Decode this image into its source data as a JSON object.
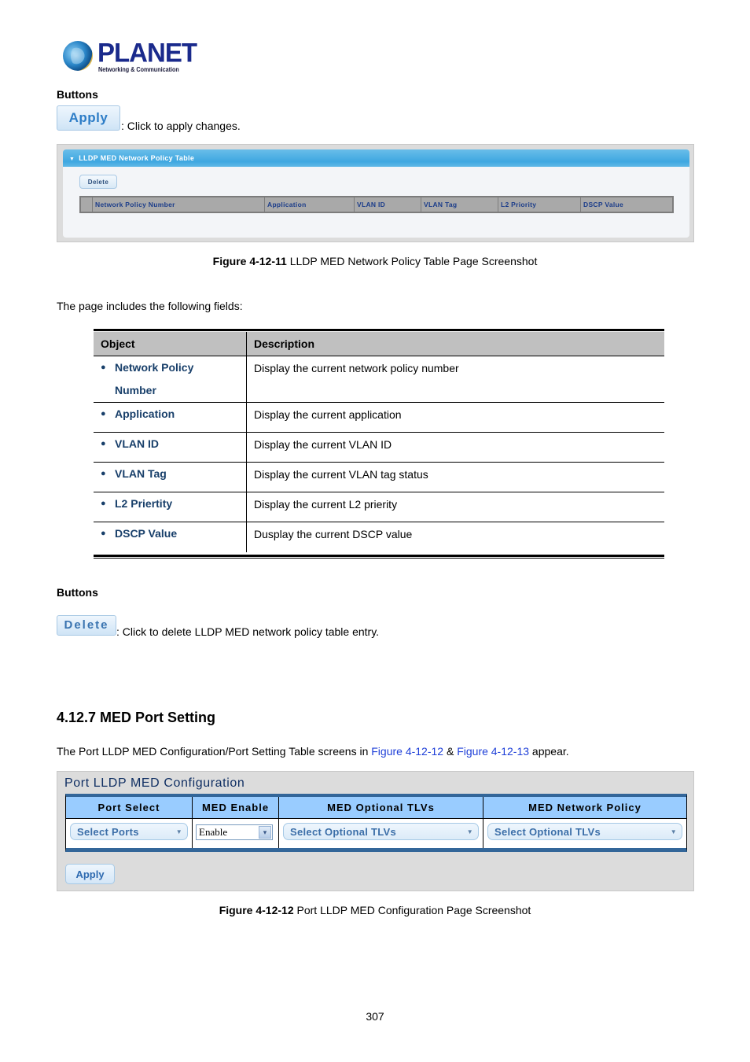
{
  "logo": {
    "brand": "PLANET",
    "tagline": "Networking & Communication"
  },
  "buttons_section_1": {
    "heading": "Buttons",
    "apply_button_label": "Apply",
    "apply_description": ": Click to apply changes."
  },
  "figure_11": {
    "panel_title": "LLDP MED Network Policy Table",
    "delete_button_label": "Delete",
    "columns": [
      "Network Policy Number",
      "Application",
      "VLAN ID",
      "VLAN Tag",
      "L2 Priority",
      "DSCP Value"
    ],
    "caption_bold": "Figure 4-12-11",
    "caption_text": " LLDP MED Network Policy Table Page Screenshot"
  },
  "intro_text": "The page includes the following fields:",
  "fields_table": {
    "headers": [
      "Object",
      "Description"
    ],
    "rows": [
      {
        "object_line1": "Network Policy",
        "object_line2": "Number",
        "description": "Display the current network policy number"
      },
      {
        "object_line1": "Application",
        "object_line2": "",
        "description": "Display the current application"
      },
      {
        "object_line1": "VLAN ID",
        "object_line2": "",
        "description": "Display the current VLAN ID"
      },
      {
        "object_line1": "VLAN Tag",
        "object_line2": "",
        "description": "Display the current VLAN tag status"
      },
      {
        "object_line1": "L2 Priertity",
        "object_line2": "",
        "description": "Display the current L2 prierity"
      },
      {
        "object_line1": "DSCP Value",
        "object_line2": "",
        "description": "Dusplay the current DSCP value"
      }
    ]
  },
  "buttons_section_2": {
    "heading": "Buttons",
    "delete_button_label": "Delete",
    "delete_description": ": Click to delete LLDP MED network policy table entry."
  },
  "section": {
    "title": "4.12.7 MED Port Setting",
    "intro_before": "The Port LLDP MED Configuration/Port Setting Table screens in ",
    "link1": "Figure 4-12-12",
    "intro_mid": " & ",
    "link2": "Figure 4-12-13",
    "intro_after": " appear."
  },
  "figure_12": {
    "title": "Port LLDP MED Configuration",
    "columns": [
      "Port Select",
      "MED Enable",
      "MED Optional TLVs",
      "MED Network Policy"
    ],
    "port_select_value": "Select Ports",
    "med_enable_value": "Enable",
    "optional_tlvs_value": "Select Optional TLVs",
    "network_policy_value": "Select Optional TLVs",
    "apply_button_label": "Apply",
    "caption_bold": "Figure 4-12-12",
    "caption_text": " Port LLDP MED Configuration Page Screenshot"
  },
  "page_number": "307",
  "colors": {
    "object_text": "#183f6a",
    "link": "#1e3fd8",
    "panel_header_blue": "#3fa8e1",
    "config_header_blue": "#99ccff",
    "config_border": "#336699"
  }
}
